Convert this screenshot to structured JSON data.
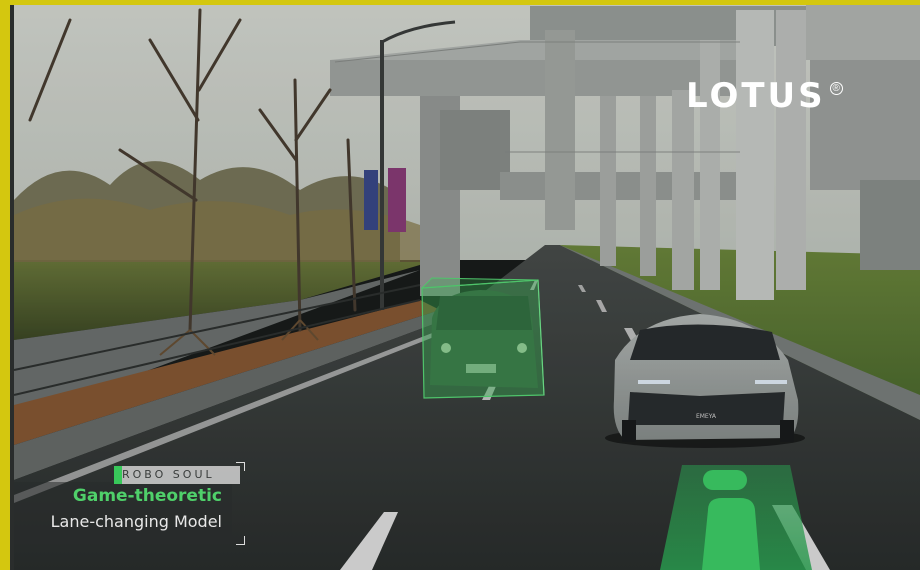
{
  "brand": {
    "logo_text": "LOTUS",
    "registered_mark": "®"
  },
  "caption": {
    "tag": "ROBO SOUL",
    "title": "Game-theoretic",
    "subtitle": "Lane-changing Model"
  },
  "car_badge": "EMEYA",
  "colors": {
    "frame_border": "#d4c70f",
    "detection_box": "#3ec45e",
    "path_marker": "#3fd46a",
    "caption_accent": "#4fd06a"
  },
  "icons": [
    "logo-registered-icon"
  ]
}
